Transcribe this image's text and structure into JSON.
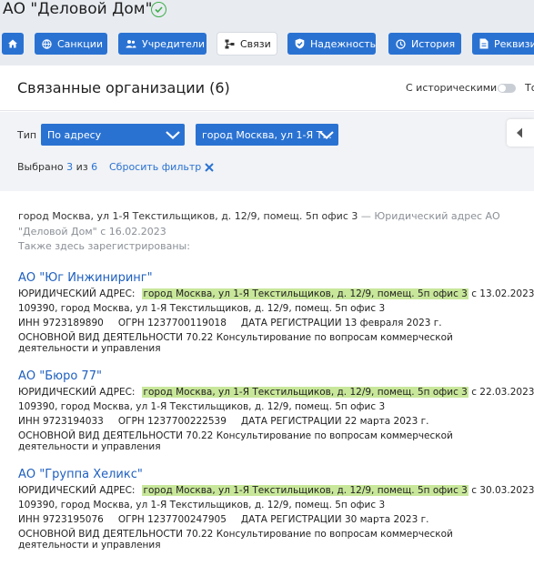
{
  "header": {
    "company_title": "АО \"Деловой Дом\""
  },
  "nav": {
    "items": [
      {
        "label": "",
        "icon": "home-icon"
      },
      {
        "label": "Санкции",
        "icon": "globe-icon"
      },
      {
        "label": "Учредители",
        "icon": "people-icon"
      },
      {
        "label": "Связи",
        "icon": "network-icon"
      },
      {
        "label": "Надежность",
        "icon": "shield-check-icon"
      },
      {
        "label": "История",
        "icon": "history-icon"
      },
      {
        "label": "Реквизиты",
        "icon": "document-icon"
      }
    ],
    "active": "Связи"
  },
  "panel": {
    "title": "Связанные организации (6)",
    "historical_label": "С историческими",
    "cut_label": "То"
  },
  "filter": {
    "type_label": "Тип",
    "type_value": "По адресу",
    "address_value": "город Москва, ул 1-Я Т...",
    "selected_prefix": "Выбрано",
    "selected_count": "3",
    "selected_of": "из",
    "selected_total": "6",
    "reset_label": "Сбросить фильтр"
  },
  "intro": {
    "address": "город Москва, ул 1-Я Текстильщиков, д. 12/9, помещ. 5п офис 3",
    "note": " — Юридический адрес АО \"Деловой Дом\" с 16.02.2023",
    "also_here": "Также здесь зарегистрированы:"
  },
  "labels": {
    "legal_address": "ЮРИДИЧЕСКИЙ АДРЕС:",
    "inn": "ИНН",
    "ogrn": "ОГРН",
    "reg_date": "ДАТА РЕГИСТРАЦИИ",
    "main_activity": "ОСНОВНОЙ ВИД ДЕЯТЕЛЬНОСТИ"
  },
  "orgs": [
    {
      "name": "АО \"Юг Инжиниринг\"",
      "address_hl": "город Москва, ул 1-Я Текстильщиков, д. 12/9, помещ. 5п офис 3",
      "since": " с 13.02.2023",
      "full_address": "109390, город Москва, ул 1-Я Текстильщиков, д. 12/9, помещ. 5п офис 3",
      "inn": "9723189890",
      "ogrn": "1237700119018",
      "reg_date": "13 февраля 2023 г.",
      "activity": "70.22 Консультирование по вопросам коммерческой деятельности и управления"
    },
    {
      "name": "АО \"Бюро 77\"",
      "address_hl": "город Москва, ул 1-Я Текстильщиков, д. 12/9, помещ. 5п офис 3",
      "since": " с 22.03.2023",
      "full_address": "109390, город Москва, ул 1-Я Текстильщиков, д. 12/9, помещ. 5п офис 3",
      "inn": "9723194033",
      "ogrn": "1237700222539",
      "reg_date": "22 марта 2023 г.",
      "activity": "70.22 Консультирование по вопросам коммерческой деятельности и управления"
    },
    {
      "name": "АО \"Группа Хеликс\"",
      "address_hl": "город Москва, ул 1-Я Текстильщиков, д. 12/9, помещ. 5п офис 3",
      "since": " с 30.03.2023",
      "full_address": "109390, город Москва, ул 1-Я Текстильщиков, д. 12/9, помещ. 5п офис 3",
      "inn": "9723195076",
      "ogrn": "1237700247905",
      "reg_date": "30 марта 2023 г.",
      "activity": "70.22 Консультирование по вопросам коммерческой деятельности и управления"
    }
  ],
  "colors": {
    "accent": "#2a72d2",
    "link": "#1e5fbf",
    "highlight": "#c8e79a",
    "ok": "#3fae4a"
  }
}
